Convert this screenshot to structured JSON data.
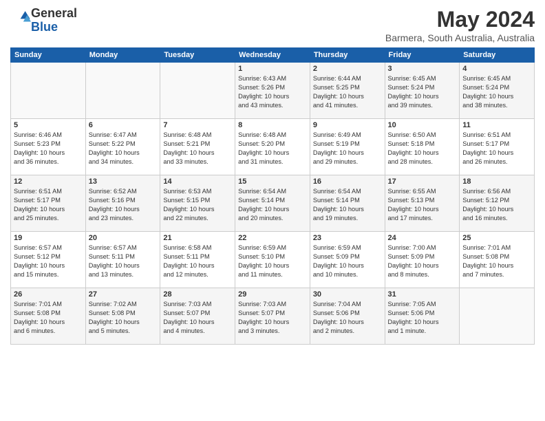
{
  "logo": {
    "general": "General",
    "blue": "Blue"
  },
  "header": {
    "title": "May 2024",
    "subtitle": "Barmera, South Australia, Australia"
  },
  "days_of_week": [
    "Sunday",
    "Monday",
    "Tuesday",
    "Wednesday",
    "Thursday",
    "Friday",
    "Saturday"
  ],
  "weeks": [
    [
      {
        "day": "",
        "text": ""
      },
      {
        "day": "",
        "text": ""
      },
      {
        "day": "",
        "text": ""
      },
      {
        "day": "1",
        "text": "Sunrise: 6:43 AM\nSunset: 5:26 PM\nDaylight: 10 hours\nand 43 minutes."
      },
      {
        "day": "2",
        "text": "Sunrise: 6:44 AM\nSunset: 5:25 PM\nDaylight: 10 hours\nand 41 minutes."
      },
      {
        "day": "3",
        "text": "Sunrise: 6:45 AM\nSunset: 5:24 PM\nDaylight: 10 hours\nand 39 minutes."
      },
      {
        "day": "4",
        "text": "Sunrise: 6:45 AM\nSunset: 5:24 PM\nDaylight: 10 hours\nand 38 minutes."
      }
    ],
    [
      {
        "day": "5",
        "text": "Sunrise: 6:46 AM\nSunset: 5:23 PM\nDaylight: 10 hours\nand 36 minutes."
      },
      {
        "day": "6",
        "text": "Sunrise: 6:47 AM\nSunset: 5:22 PM\nDaylight: 10 hours\nand 34 minutes."
      },
      {
        "day": "7",
        "text": "Sunrise: 6:48 AM\nSunset: 5:21 PM\nDaylight: 10 hours\nand 33 minutes."
      },
      {
        "day": "8",
        "text": "Sunrise: 6:48 AM\nSunset: 5:20 PM\nDaylight: 10 hours\nand 31 minutes."
      },
      {
        "day": "9",
        "text": "Sunrise: 6:49 AM\nSunset: 5:19 PM\nDaylight: 10 hours\nand 29 minutes."
      },
      {
        "day": "10",
        "text": "Sunrise: 6:50 AM\nSunset: 5:18 PM\nDaylight: 10 hours\nand 28 minutes."
      },
      {
        "day": "11",
        "text": "Sunrise: 6:51 AM\nSunset: 5:17 PM\nDaylight: 10 hours\nand 26 minutes."
      }
    ],
    [
      {
        "day": "12",
        "text": "Sunrise: 6:51 AM\nSunset: 5:17 PM\nDaylight: 10 hours\nand 25 minutes."
      },
      {
        "day": "13",
        "text": "Sunrise: 6:52 AM\nSunset: 5:16 PM\nDaylight: 10 hours\nand 23 minutes."
      },
      {
        "day": "14",
        "text": "Sunrise: 6:53 AM\nSunset: 5:15 PM\nDaylight: 10 hours\nand 22 minutes."
      },
      {
        "day": "15",
        "text": "Sunrise: 6:54 AM\nSunset: 5:14 PM\nDaylight: 10 hours\nand 20 minutes."
      },
      {
        "day": "16",
        "text": "Sunrise: 6:54 AM\nSunset: 5:14 PM\nDaylight: 10 hours\nand 19 minutes."
      },
      {
        "day": "17",
        "text": "Sunrise: 6:55 AM\nSunset: 5:13 PM\nDaylight: 10 hours\nand 17 minutes."
      },
      {
        "day": "18",
        "text": "Sunrise: 6:56 AM\nSunset: 5:12 PM\nDaylight: 10 hours\nand 16 minutes."
      }
    ],
    [
      {
        "day": "19",
        "text": "Sunrise: 6:57 AM\nSunset: 5:12 PM\nDaylight: 10 hours\nand 15 minutes."
      },
      {
        "day": "20",
        "text": "Sunrise: 6:57 AM\nSunset: 5:11 PM\nDaylight: 10 hours\nand 13 minutes."
      },
      {
        "day": "21",
        "text": "Sunrise: 6:58 AM\nSunset: 5:11 PM\nDaylight: 10 hours\nand 12 minutes."
      },
      {
        "day": "22",
        "text": "Sunrise: 6:59 AM\nSunset: 5:10 PM\nDaylight: 10 hours\nand 11 minutes."
      },
      {
        "day": "23",
        "text": "Sunrise: 6:59 AM\nSunset: 5:09 PM\nDaylight: 10 hours\nand 10 minutes."
      },
      {
        "day": "24",
        "text": "Sunrise: 7:00 AM\nSunset: 5:09 PM\nDaylight: 10 hours\nand 8 minutes."
      },
      {
        "day": "25",
        "text": "Sunrise: 7:01 AM\nSunset: 5:08 PM\nDaylight: 10 hours\nand 7 minutes."
      }
    ],
    [
      {
        "day": "26",
        "text": "Sunrise: 7:01 AM\nSunset: 5:08 PM\nDaylight: 10 hours\nand 6 minutes."
      },
      {
        "day": "27",
        "text": "Sunrise: 7:02 AM\nSunset: 5:08 PM\nDaylight: 10 hours\nand 5 minutes."
      },
      {
        "day": "28",
        "text": "Sunrise: 7:03 AM\nSunset: 5:07 PM\nDaylight: 10 hours\nand 4 minutes."
      },
      {
        "day": "29",
        "text": "Sunrise: 7:03 AM\nSunset: 5:07 PM\nDaylight: 10 hours\nand 3 minutes."
      },
      {
        "day": "30",
        "text": "Sunrise: 7:04 AM\nSunset: 5:06 PM\nDaylight: 10 hours\nand 2 minutes."
      },
      {
        "day": "31",
        "text": "Sunrise: 7:05 AM\nSunset: 5:06 PM\nDaylight: 10 hours\nand 1 minute."
      },
      {
        "day": "",
        "text": ""
      }
    ]
  ]
}
